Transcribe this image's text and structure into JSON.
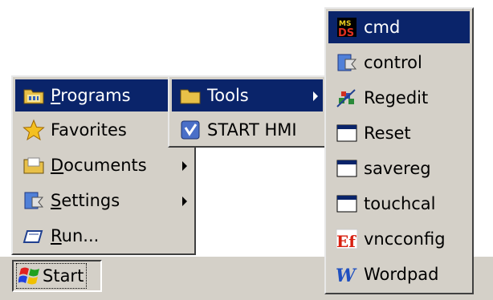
{
  "taskbar": {
    "start_label": "Start"
  },
  "start_menu": {
    "items": [
      {
        "label": "Programs",
        "icon": "programs-folder-icon",
        "submenu": true
      },
      {
        "label": "Favorites",
        "icon": "favorites-star-icon",
        "submenu": false
      },
      {
        "label": "Documents",
        "icon": "documents-folder-icon",
        "submenu": true
      },
      {
        "label": "Settings",
        "icon": "settings-icon",
        "submenu": true
      },
      {
        "label": "Run...",
        "icon": "run-icon",
        "submenu": false
      }
    ]
  },
  "programs_menu": {
    "items": [
      {
        "label": "Tools",
        "icon": "folder-icon",
        "submenu": true
      },
      {
        "label": "START HMI",
        "icon": "start-hmi-icon",
        "submenu": false
      }
    ]
  },
  "tools_menu": {
    "items": [
      {
        "label": "cmd",
        "icon": "ms-dos-icon"
      },
      {
        "label": "control",
        "icon": "control-panel-icon"
      },
      {
        "label": "Regedit",
        "icon": "regedit-icon"
      },
      {
        "label": "Reset",
        "icon": "window-icon"
      },
      {
        "label": "savereg",
        "icon": "window-icon"
      },
      {
        "label": "touchcal",
        "icon": "window-icon"
      },
      {
        "label": "vncconfig",
        "icon": "vnc-icon"
      },
      {
        "label": "Wordpad",
        "icon": "wordpad-icon"
      }
    ]
  },
  "colors": {
    "menu_bg": "#d4d0c8",
    "highlight": "#0a246a",
    "highlight_text": "#ffffff"
  }
}
